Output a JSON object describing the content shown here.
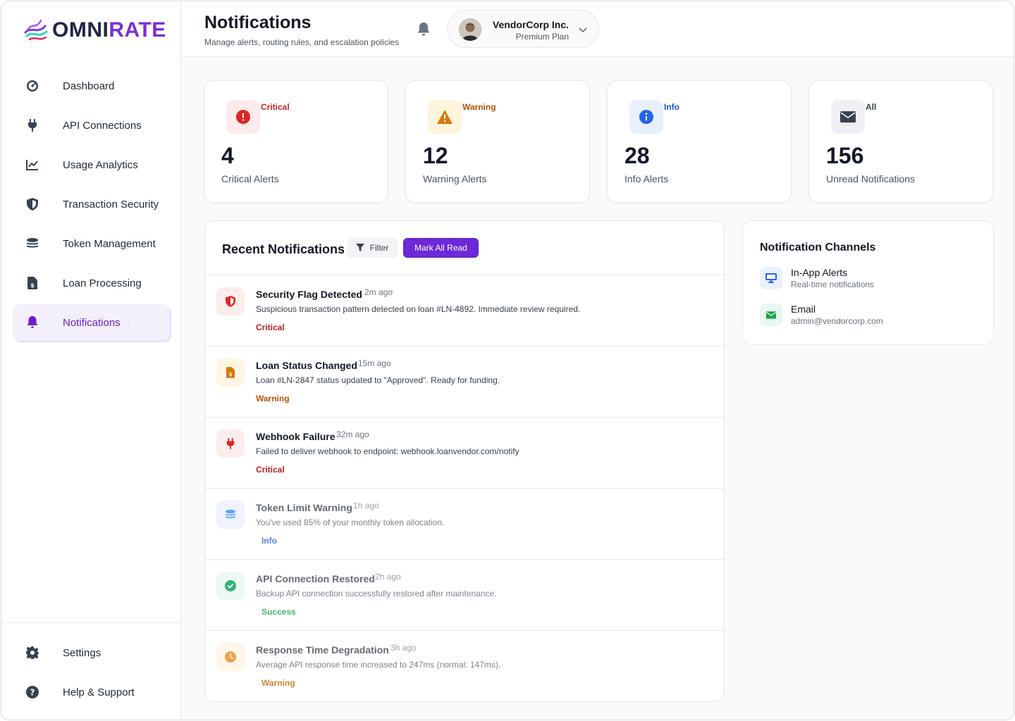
{
  "brand": {
    "name_prefix": "OMNI",
    "name_suffix": "RATE",
    "accent": "#7c2fd6"
  },
  "sidebar": {
    "items": [
      {
        "label": "Dashboard",
        "icon": "gauge-icon"
      },
      {
        "label": "API Connections",
        "icon": "plug-icon"
      },
      {
        "label": "Usage Analytics",
        "icon": "line-chart-icon"
      },
      {
        "label": "Transaction Security",
        "icon": "shield-icon"
      },
      {
        "label": "Token Management",
        "icon": "coins-icon"
      },
      {
        "label": "Loan Processing",
        "icon": "document-dollar-icon"
      },
      {
        "label": "Notifications",
        "icon": "bell-icon",
        "active": true
      }
    ],
    "bottom": [
      {
        "label": "Settings",
        "icon": "gear-icon"
      },
      {
        "label": "Help & Support",
        "icon": "question-icon"
      }
    ]
  },
  "header": {
    "title": "Notifications",
    "subtitle": "Manage alerts, routing rules, and escalation policies",
    "account": {
      "name": "VendorCorp Inc.",
      "plan": "Premium Plan"
    }
  },
  "stats": [
    {
      "tag": "Critical",
      "value": "4",
      "label": "Critical Alerts",
      "color": "#c81e1e"
    },
    {
      "tag": "Warning",
      "value": "12",
      "label": "Warning Alerts",
      "color": "#b45309"
    },
    {
      "tag": "Info",
      "value": "28",
      "label": "Info Alerts",
      "color": "#1d4ed8"
    },
    {
      "tag": "All",
      "value": "156",
      "label": "Unread Notifications",
      "color": "#374151"
    }
  ],
  "recent": {
    "title": "Recent Notifications",
    "filter_label": "Filter",
    "mark_all_label": "Mark All Read",
    "items": [
      {
        "title": "Security Flag Detected",
        "time": "2m ago",
        "desc": "Suspicious transaction pattern detected on loan #LN-4892. Immediate review required.",
        "tag": "Critical",
        "icon": "shield-icon"
      },
      {
        "title": "Loan Status Changed",
        "time": "15m ago",
        "desc": "Loan #LN-2847 status updated to \"Approved\". Ready for funding.",
        "tag": "Warning",
        "icon": "document-dollar-icon"
      },
      {
        "title": "Webhook Failure",
        "time": "32m ago",
        "desc": "Failed to deliver webhook to endpoint: webhook.loanvendor.com/notify",
        "tag": "Critical",
        "icon": "plug-icon"
      },
      {
        "title": "Token Limit Warning",
        "time": "1h ago",
        "desc": "You've used 85% of your monthly token allocation.",
        "tag": "Info",
        "icon": "coins-icon"
      },
      {
        "title": "API Connection Restored",
        "time": "2h ago",
        "desc": "Backup API connection successfully restored after maintenance.",
        "tag": "Success",
        "icon": "check-circle-icon"
      },
      {
        "title": "Response Time Degradation",
        "time": "3h ago",
        "desc": "Average API response time increased to 247ms (normal: 147ms).",
        "tag": "Warning",
        "icon": "clock-icon"
      }
    ]
  },
  "channels": {
    "title": "Notification Channels",
    "items": [
      {
        "name": "In-App Alerts",
        "sub": "Real-time notifications",
        "icon": "monitor-icon"
      },
      {
        "name": "Email",
        "sub": "admin@vendorcorp.com",
        "icon": "envelope-icon"
      }
    ]
  }
}
